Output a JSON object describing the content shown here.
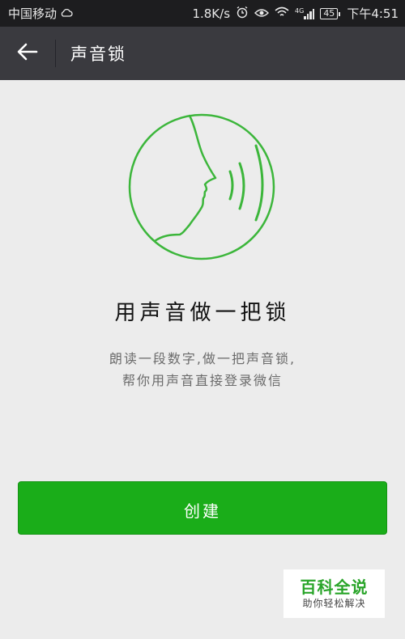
{
  "status_bar": {
    "carrier": "中国移动",
    "speed": "1.8K/s",
    "network": "4G",
    "battery": "45",
    "time": "下午4:51"
  },
  "header": {
    "title": "声音锁"
  },
  "main": {
    "headline": "用声音做一把锁",
    "description_line1": "朗读一段数字,做一把声音锁,",
    "description_line2": "帮你用声音直接登录微信",
    "create_label": "创建"
  },
  "watermark": {
    "title": "百科全说",
    "subtitle": "助你轻松解决"
  },
  "colors": {
    "accent_green": "#1aad19",
    "title_bar": "#3a3a3f",
    "status_bar": "#1d1d1f",
    "background": "#ececec"
  }
}
